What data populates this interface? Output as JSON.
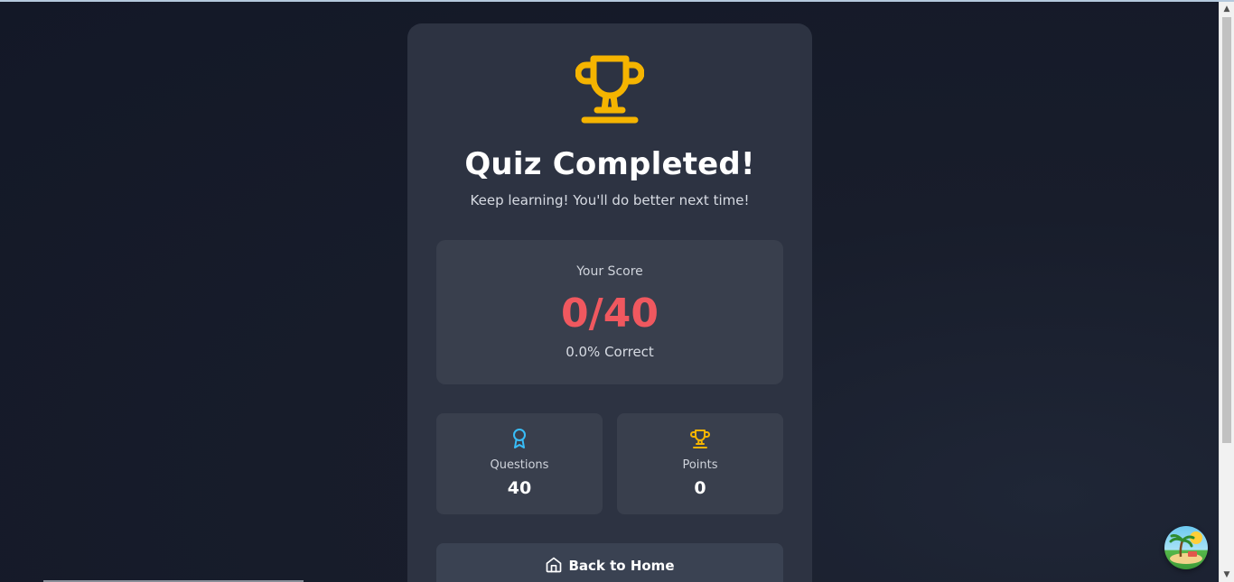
{
  "result": {
    "title": "Quiz Completed!",
    "message": "Keep learning! You'll do better next time!"
  },
  "score": {
    "label": "Your Score",
    "value": "0/40",
    "percent_text": "0.0% Correct",
    "color": "#f0585f"
  },
  "stats": [
    {
      "label": "Questions",
      "value": "40",
      "icon": "award-icon",
      "icon_color": "#38bdf8"
    },
    {
      "label": "Points",
      "value": "0",
      "icon": "trophy-icon",
      "icon_color": "#f5b400"
    }
  ],
  "actions": {
    "home_label": "Back to Home",
    "home_icon": "home-icon"
  },
  "colors": {
    "trophy": "#f5b400",
    "card_bg": "#2d3342",
    "panel_bg": "#393f4d",
    "page_bg": "#151a28"
  },
  "floating_button": {
    "icon": "beach-island-icon"
  }
}
